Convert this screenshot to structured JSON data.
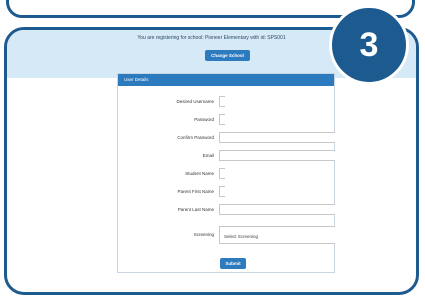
{
  "banner": {
    "text": "You are registering for school: Pioneer Elementary with id: SPS001",
    "change_school_label": "Change School"
  },
  "step_badge": "3",
  "form": {
    "header": "User Details",
    "fields": [
      {
        "label": "Desired Username",
        "value": ""
      },
      {
        "label": "Password",
        "value": ""
      },
      {
        "label": "Confirm Password",
        "value": ""
      },
      {
        "label": "Email",
        "value": ""
      },
      {
        "label": "Student Name",
        "value": ""
      },
      {
        "label": "Parent First Name",
        "value": ""
      },
      {
        "label": "Parent Last Name",
        "value": ""
      },
      {
        "label": "Screening",
        "value": "Select Screening"
      }
    ],
    "submit_label": "Submit"
  },
  "colors": {
    "border": "#1d5a8f",
    "accent": "#2d7bbf",
    "banner_bg": "#d6e9f6"
  }
}
